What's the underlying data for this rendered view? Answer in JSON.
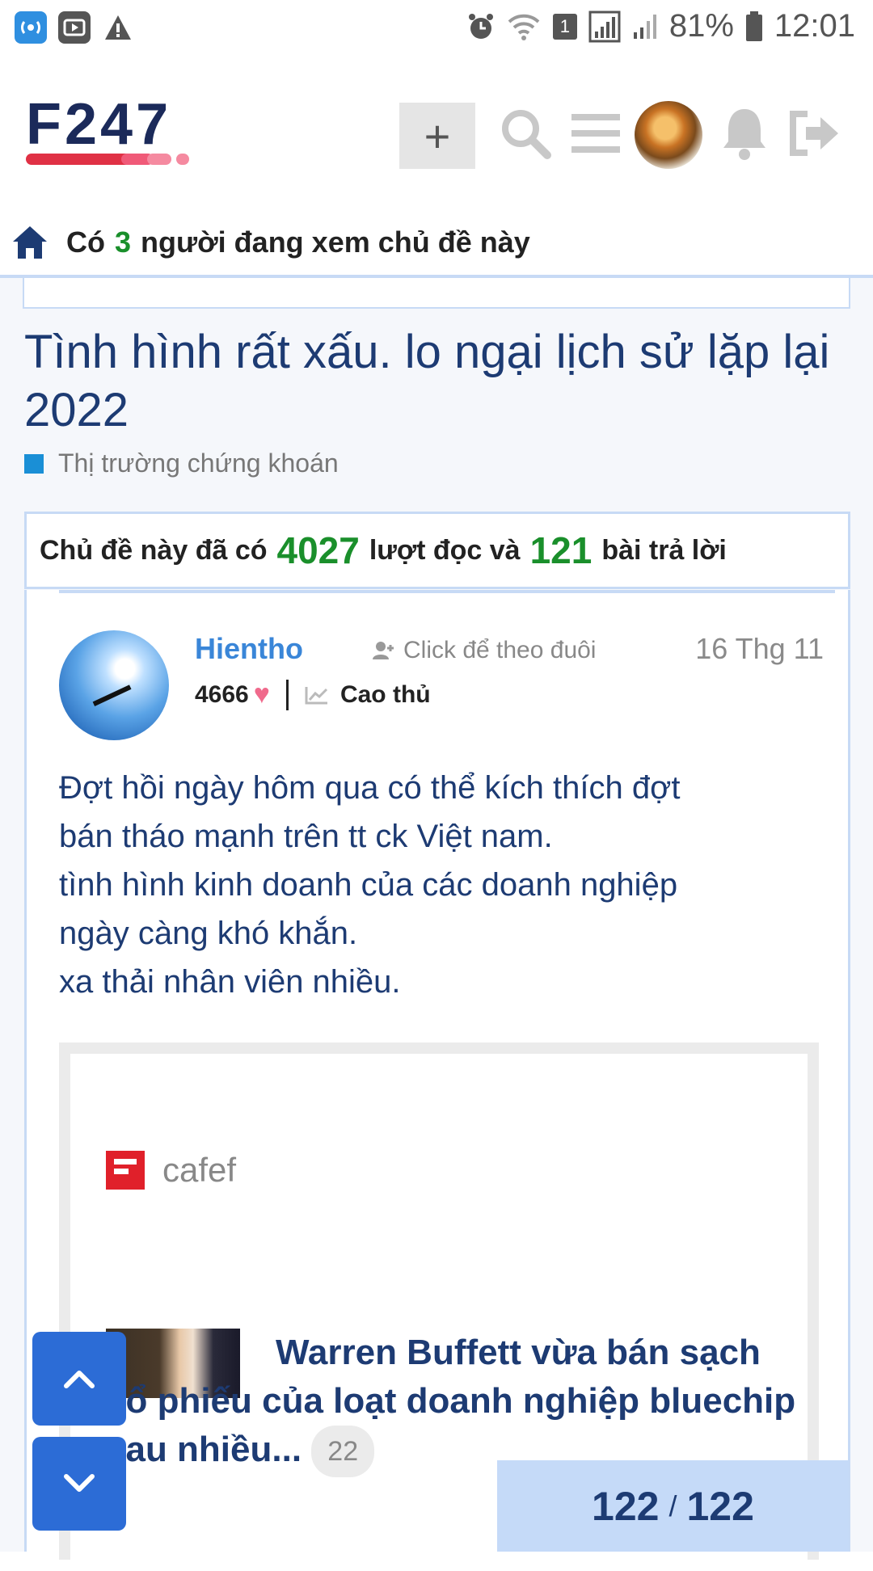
{
  "status_bar": {
    "battery": "81%",
    "time": "12:01",
    "sim": "1"
  },
  "header": {
    "logo_text": "F247",
    "add_label": "+"
  },
  "viewing": {
    "prefix": "Có",
    "count": "3",
    "suffix": "người đang xem chủ đề này"
  },
  "topic": {
    "title": "Tình hình rất xấu. lo ngại lịch sử lặp lại 2022",
    "category": "Thị trường chứng khoán",
    "category_color": "#1a8fd6",
    "stats": {
      "prefix": "Chủ đề này đã có",
      "views": "4027",
      "mid": "lượt đọc và",
      "replies": "121",
      "suffix": "bài trả lời"
    }
  },
  "post": {
    "username": "Hientho",
    "follow_label": "Click để theo đuôi",
    "date": "16 Thg 11",
    "points": "4666",
    "rank": "Cao thủ",
    "body_lines": [
      "Đợt hồi ngày hôm qua có thể kích thích đợt",
      "bán tháo mạnh trên tt ck Việt nam.",
      "tình hình kinh doanh của các doanh nghiệp",
      "ngày càng khó khắn.",
      "xa thải nhân viên nhiều."
    ],
    "embed": {
      "source": "cafef",
      "headline": "Warren Buffett vừa bán sạch cổ phiếu của loạt doanh nghiệp bluechip sau nhiều...",
      "click_count": "22"
    }
  },
  "pager": {
    "current": "122",
    "total": "122"
  },
  "colors": {
    "accent_green": "#1a8f2b",
    "title_blue": "#1d3b73",
    "nav_button": "#2c6cd6"
  }
}
